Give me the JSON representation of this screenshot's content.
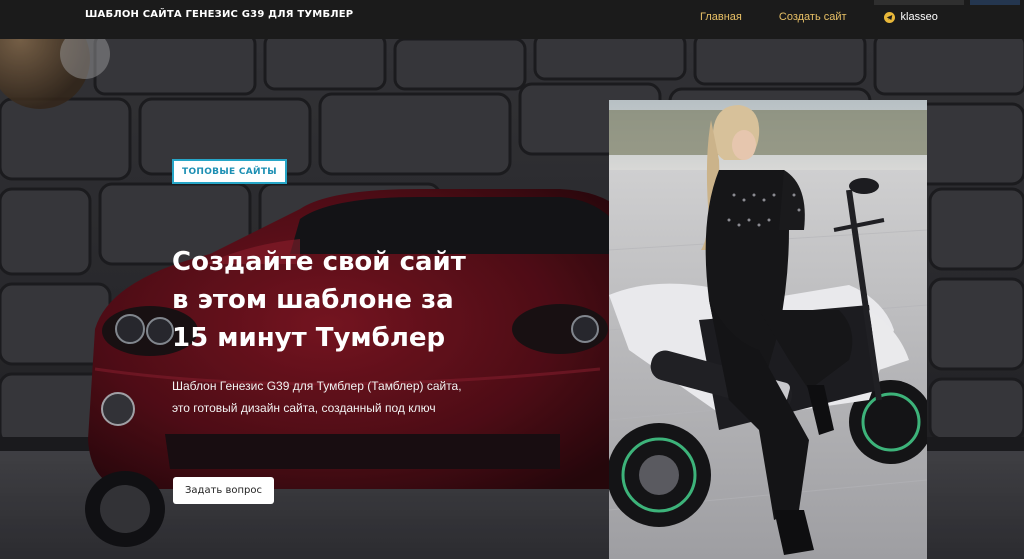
{
  "header": {
    "site_title": "ШАБЛОН САЙТА ГЕНЕЗИС G39 ДЛЯ ТУМБЛЕР",
    "nav": [
      {
        "label": "Главная"
      },
      {
        "label": "Создать сайт"
      },
      {
        "label": "klasseo"
      }
    ]
  },
  "hero": {
    "badge": "ТОПОВЫЕ САЙТЫ",
    "headline_lines": [
      "Создайте свой сайт",
      "в этом шаблоне за",
      "15 минут Тумблер"
    ],
    "subtext_lines": [
      "Шаблон Генезис G39 для Тумблер (Тамблер) сайта,",
      "это готовый дизайн сайта, созданный под ключ"
    ],
    "cta_label": "Задать вопрос"
  },
  "colors": {
    "header_bg": "#1b1b1b",
    "nav_link": "#e8c066",
    "badge_border": "#27a6c7",
    "badge_text": "#1c8fb3",
    "car_red": "#6d0f1a"
  },
  "icons": {
    "user_icon": "telegram-like-circle-icon"
  }
}
